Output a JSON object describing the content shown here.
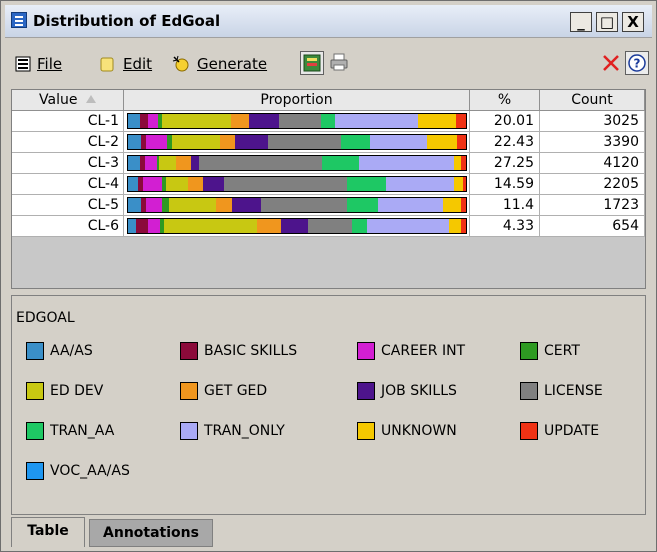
{
  "window": {
    "title": "Distribution of EdGoal"
  },
  "window_buttons": {
    "minimize": "_",
    "maximize": "□",
    "close": "X"
  },
  "menu": {
    "file": "File",
    "edit": "Edit",
    "generate": "Generate"
  },
  "table": {
    "headers": {
      "value": "Value",
      "proportion": "Proportion",
      "percent": "%",
      "count": "Count"
    },
    "rows": [
      {
        "value": "CL-1",
        "percent": "20.01",
        "count": "3025",
        "proportion": [
          3.0,
          2.0,
          2.5,
          1.0,
          17.0,
          4.5,
          7.5,
          10.5,
          3.5,
          20.5,
          9.5,
          2.5
        ]
      },
      {
        "value": "CL-2",
        "percent": "22.43",
        "count": "3390",
        "proportion": [
          3.5,
          1.5,
          5.5,
          1.5,
          13.0,
          4.0,
          9.0,
          20.0,
          8.0,
          15.5,
          8.0,
          2.5
        ]
      },
      {
        "value": "CL-3",
        "percent": "27.25",
        "count": "4120",
        "proportion": [
          3.5,
          1.5,
          3.5,
          0.5,
          5.0,
          4.5,
          2.5,
          36.0,
          11.0,
          28.0,
          2.0,
          1.5
        ]
      },
      {
        "value": "CL-4",
        "percent": "14.59",
        "count": "2205",
        "proportion": [
          3.0,
          1.5,
          5.5,
          1.0,
          6.5,
          4.5,
          6.0,
          36.0,
          11.5,
          20.0,
          2.5,
          1.0
        ]
      },
      {
        "value": "CL-5",
        "percent": "11.4",
        "count": "1723",
        "proportion": [
          3.5,
          1.5,
          4.5,
          2.0,
          13.0,
          4.5,
          8.0,
          24.0,
          8.5,
          18.0,
          5.0,
          1.5
        ]
      },
      {
        "value": "CL-6",
        "percent": "4.33",
        "count": "654",
        "proportion": [
          2.5,
          3.5,
          3.5,
          1.0,
          27.5,
          7.0,
          8.0,
          13.0,
          4.5,
          24.0,
          3.5,
          1.5
        ]
      }
    ]
  },
  "legend": {
    "title": "EDGOAL",
    "items": [
      {
        "label": "AA/AS",
        "color": "#3a8fc8"
      },
      {
        "label": "BASIC SKILLS",
        "color": "#8b0a3a"
      },
      {
        "label": "CAREER INT",
        "color": "#d21fd2"
      },
      {
        "label": "CERT",
        "color": "#2e9a22"
      },
      {
        "label": "ED DEV",
        "color": "#c8c812"
      },
      {
        "label": "GET GED",
        "color": "#f0961e"
      },
      {
        "label": "JOB SKILLS",
        "color": "#4d148c"
      },
      {
        "label": "LICENSE",
        "color": "#808080"
      },
      {
        "label": "TRAN_AA",
        "color": "#1ec864"
      },
      {
        "label": "TRAN_ONLY",
        "color": "#aaaaf5"
      },
      {
        "label": "UNKNOWN",
        "color": "#f5c800"
      },
      {
        "label": "UPDATE",
        "color": "#f03214"
      },
      {
        "label": "VOC_AA/AS",
        "color": "#1e96f0"
      }
    ]
  },
  "tabs": [
    {
      "label": "Table"
    },
    {
      "label": "Annotations"
    }
  ]
}
